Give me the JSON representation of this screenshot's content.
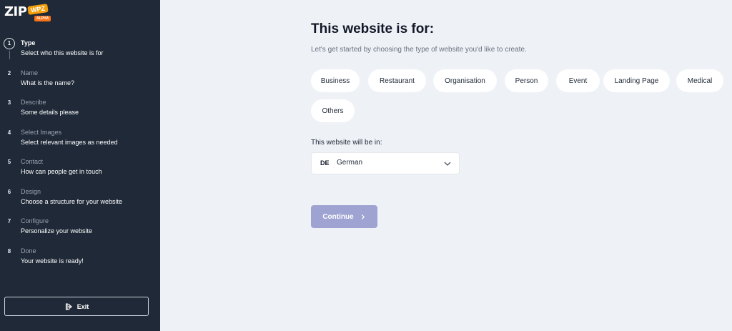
{
  "logo": {
    "text": "ZIP",
    "badge": "WPZ",
    "tag": "ALPHA"
  },
  "steps": [
    {
      "num": "1",
      "title": "Type",
      "desc": "Select who this website is for",
      "active": true
    },
    {
      "num": "2",
      "title": "Name",
      "desc": "What is the name?"
    },
    {
      "num": "3",
      "title": "Describe",
      "desc": "Some details please"
    },
    {
      "num": "4",
      "title": "Select Images",
      "desc": "Select relevant images as needed"
    },
    {
      "num": "5",
      "title": "Contact",
      "desc": "How can people get in touch"
    },
    {
      "num": "6",
      "title": "Design",
      "desc": "Choose a structure for your website"
    },
    {
      "num": "7",
      "title": "Configure",
      "desc": "Personalize your website"
    },
    {
      "num": "8",
      "title": "Done",
      "desc": "Your website is ready!"
    }
  ],
  "exit_label": "Exit",
  "heading": "This website is for:",
  "subheading": "Let's get started by choosing the type of website you'd like to create.",
  "types": [
    "Business",
    "Restaurant",
    "Organisation",
    "Person",
    "Event",
    "Landing Page",
    "Medical",
    "Others"
  ],
  "language": {
    "label": "This website will be in:",
    "code": "DE",
    "name": "German"
  },
  "continue_label": "Continue",
  "colors": {
    "sidebar": "#1f2937",
    "background": "#eef1f6",
    "continue": "#9ea3d1",
    "accent": "#f59e0b"
  }
}
